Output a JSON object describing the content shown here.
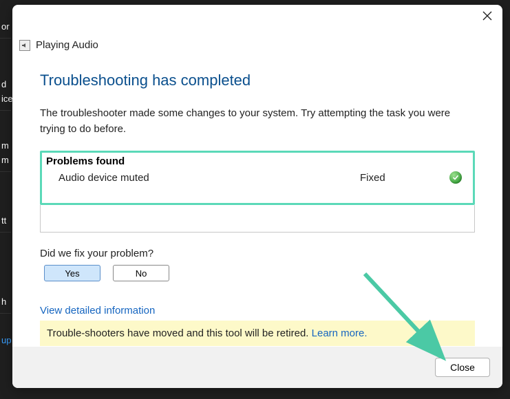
{
  "modal": {
    "title": "Playing Audio",
    "heading": "Troubleshooting has completed",
    "subtext": "The troubleshooter made some changes to your system. Try attempting the task you were trying to do before.",
    "problems_header": "Problems found",
    "problems": [
      {
        "name": "Audio device muted",
        "status": "Fixed"
      }
    ],
    "didwefix": "Did we fix your problem?",
    "yes_label": "Yes",
    "no_label": "No",
    "detail_link": "View detailed information",
    "banner_text": "Trouble-shooters have moved and this tool will be retired. ",
    "banner_link": "Learn more.",
    "close_label": "Close"
  },
  "bg": {
    "a": "or",
    "b": "d",
    "c": "ice",
    "d": "m",
    "e": "m",
    "f": "tt",
    "g": "h",
    "h": "up"
  },
  "colors": {
    "accent_heading": "#0a4f8d",
    "link": "#1565c0",
    "highlight_border": "#5bd9b8",
    "banner_bg": "#fdf9c9",
    "arrow": "#4bc9a5"
  }
}
